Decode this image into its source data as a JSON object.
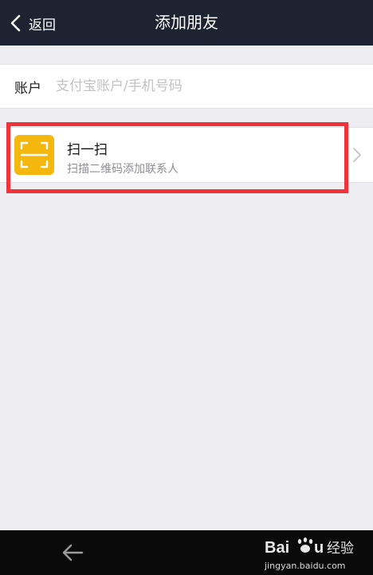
{
  "header": {
    "back_label": "返回",
    "title": "添加朋友"
  },
  "account": {
    "label": "账户",
    "placeholder": "支付宝账户/手机号码"
  },
  "scan": {
    "title": "扫一扫",
    "subtitle": "扫描二维码添加联系人",
    "icon": "scan-icon"
  },
  "colors": {
    "header_bg": "#1d2330",
    "scan_icon_bg": "#f4b70e",
    "highlight": "#f0333b",
    "page_bg": "#eeeef2"
  },
  "watermark": {
    "url": "jingyan.baidu.com"
  }
}
